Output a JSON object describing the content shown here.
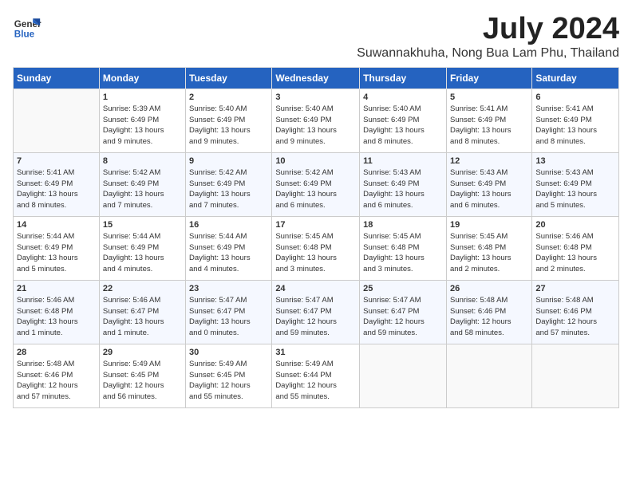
{
  "header": {
    "logo_line1": "General",
    "logo_line2": "Blue",
    "month_title": "July 2024",
    "subtitle": "Suwannakhuha, Nong Bua Lam Phu, Thailand"
  },
  "weekdays": [
    "Sunday",
    "Monday",
    "Tuesday",
    "Wednesday",
    "Thursday",
    "Friday",
    "Saturday"
  ],
  "weeks": [
    [
      {
        "day": "",
        "detail": ""
      },
      {
        "day": "1",
        "detail": "Sunrise: 5:39 AM\nSunset: 6:49 PM\nDaylight: 13 hours\nand 9 minutes."
      },
      {
        "day": "2",
        "detail": "Sunrise: 5:40 AM\nSunset: 6:49 PM\nDaylight: 13 hours\nand 9 minutes."
      },
      {
        "day": "3",
        "detail": "Sunrise: 5:40 AM\nSunset: 6:49 PM\nDaylight: 13 hours\nand 9 minutes."
      },
      {
        "day": "4",
        "detail": "Sunrise: 5:40 AM\nSunset: 6:49 PM\nDaylight: 13 hours\nand 8 minutes."
      },
      {
        "day": "5",
        "detail": "Sunrise: 5:41 AM\nSunset: 6:49 PM\nDaylight: 13 hours\nand 8 minutes."
      },
      {
        "day": "6",
        "detail": "Sunrise: 5:41 AM\nSunset: 6:49 PM\nDaylight: 13 hours\nand 8 minutes."
      }
    ],
    [
      {
        "day": "7",
        "detail": "Sunrise: 5:41 AM\nSunset: 6:49 PM\nDaylight: 13 hours\nand 8 minutes."
      },
      {
        "day": "8",
        "detail": "Sunrise: 5:42 AM\nSunset: 6:49 PM\nDaylight: 13 hours\nand 7 minutes."
      },
      {
        "day": "9",
        "detail": "Sunrise: 5:42 AM\nSunset: 6:49 PM\nDaylight: 13 hours\nand 7 minutes."
      },
      {
        "day": "10",
        "detail": "Sunrise: 5:42 AM\nSunset: 6:49 PM\nDaylight: 13 hours\nand 6 minutes."
      },
      {
        "day": "11",
        "detail": "Sunrise: 5:43 AM\nSunset: 6:49 PM\nDaylight: 13 hours\nand 6 minutes."
      },
      {
        "day": "12",
        "detail": "Sunrise: 5:43 AM\nSunset: 6:49 PM\nDaylight: 13 hours\nand 6 minutes."
      },
      {
        "day": "13",
        "detail": "Sunrise: 5:43 AM\nSunset: 6:49 PM\nDaylight: 13 hours\nand 5 minutes."
      }
    ],
    [
      {
        "day": "14",
        "detail": "Sunrise: 5:44 AM\nSunset: 6:49 PM\nDaylight: 13 hours\nand 5 minutes."
      },
      {
        "day": "15",
        "detail": "Sunrise: 5:44 AM\nSunset: 6:49 PM\nDaylight: 13 hours\nand 4 minutes."
      },
      {
        "day": "16",
        "detail": "Sunrise: 5:44 AM\nSunset: 6:49 PM\nDaylight: 13 hours\nand 4 minutes."
      },
      {
        "day": "17",
        "detail": "Sunrise: 5:45 AM\nSunset: 6:48 PM\nDaylight: 13 hours\nand 3 minutes."
      },
      {
        "day": "18",
        "detail": "Sunrise: 5:45 AM\nSunset: 6:48 PM\nDaylight: 13 hours\nand 3 minutes."
      },
      {
        "day": "19",
        "detail": "Sunrise: 5:45 AM\nSunset: 6:48 PM\nDaylight: 13 hours\nand 2 minutes."
      },
      {
        "day": "20",
        "detail": "Sunrise: 5:46 AM\nSunset: 6:48 PM\nDaylight: 13 hours\nand 2 minutes."
      }
    ],
    [
      {
        "day": "21",
        "detail": "Sunrise: 5:46 AM\nSunset: 6:48 PM\nDaylight: 13 hours\nand 1 minute."
      },
      {
        "day": "22",
        "detail": "Sunrise: 5:46 AM\nSunset: 6:47 PM\nDaylight: 13 hours\nand 1 minute."
      },
      {
        "day": "23",
        "detail": "Sunrise: 5:47 AM\nSunset: 6:47 PM\nDaylight: 13 hours\nand 0 minutes."
      },
      {
        "day": "24",
        "detail": "Sunrise: 5:47 AM\nSunset: 6:47 PM\nDaylight: 12 hours\nand 59 minutes."
      },
      {
        "day": "25",
        "detail": "Sunrise: 5:47 AM\nSunset: 6:47 PM\nDaylight: 12 hours\nand 59 minutes."
      },
      {
        "day": "26",
        "detail": "Sunrise: 5:48 AM\nSunset: 6:46 PM\nDaylight: 12 hours\nand 58 minutes."
      },
      {
        "day": "27",
        "detail": "Sunrise: 5:48 AM\nSunset: 6:46 PM\nDaylight: 12 hours\nand 57 minutes."
      }
    ],
    [
      {
        "day": "28",
        "detail": "Sunrise: 5:48 AM\nSunset: 6:46 PM\nDaylight: 12 hours\nand 57 minutes."
      },
      {
        "day": "29",
        "detail": "Sunrise: 5:49 AM\nSunset: 6:45 PM\nDaylight: 12 hours\nand 56 minutes."
      },
      {
        "day": "30",
        "detail": "Sunrise: 5:49 AM\nSunset: 6:45 PM\nDaylight: 12 hours\nand 55 minutes."
      },
      {
        "day": "31",
        "detail": "Sunrise: 5:49 AM\nSunset: 6:44 PM\nDaylight: 12 hours\nand 55 minutes."
      },
      {
        "day": "",
        "detail": ""
      },
      {
        "day": "",
        "detail": ""
      },
      {
        "day": "",
        "detail": ""
      }
    ]
  ]
}
